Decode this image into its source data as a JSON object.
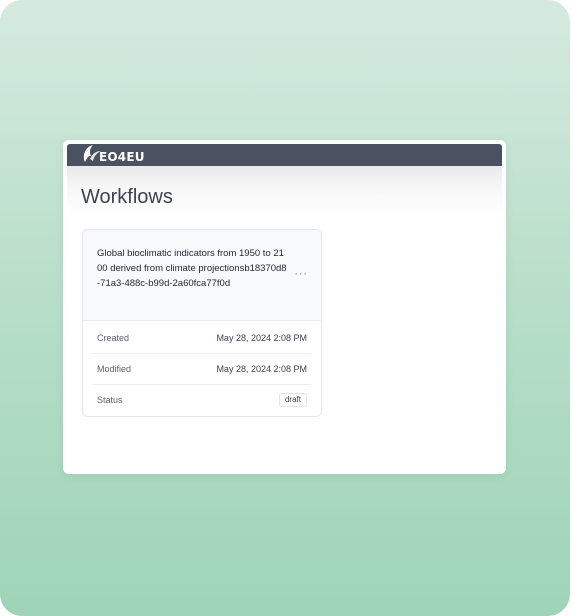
{
  "app": {
    "logo_text": "EO4EU"
  },
  "page": {
    "title": "Workflows"
  },
  "workflow_card": {
    "title": "Global bioclimatic indicators from 1950 to 2100 derived from climate projectionsb18370d8-71a3-488c-b99d-2a60fca77f0d",
    "more_icon": "ellipsis-icon",
    "more_glyph": "···",
    "fields": [
      {
        "label": "Created",
        "value": "May 28, 2024 2:08 PM"
      },
      {
        "label": "Modified",
        "value": "May 28, 2024 2:08 PM"
      },
      {
        "label": "Status",
        "value": "draft"
      }
    ]
  },
  "colors": {
    "topbar": "#4a5160",
    "title_text": "#3b4250",
    "background_gradient_top": "#d5eadf",
    "background_gradient_bottom": "#9fd4b8"
  }
}
